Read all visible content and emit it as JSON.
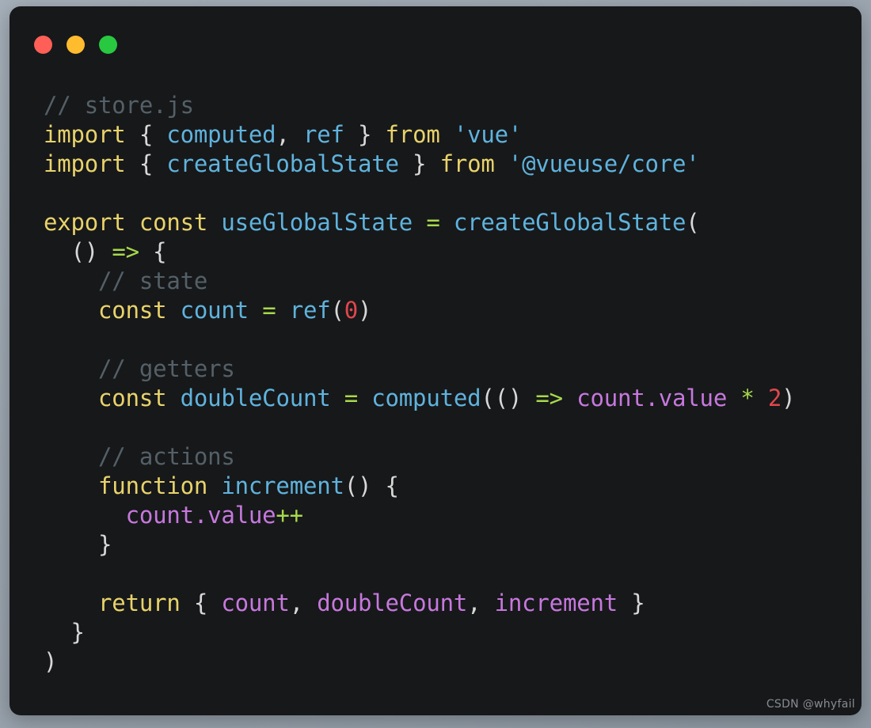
{
  "window": {
    "traffic_lights": [
      {
        "name": "close",
        "color": "#ff5f57"
      },
      {
        "name": "minimize",
        "color": "#febc2e"
      },
      {
        "name": "maximize",
        "color": "#28c840"
      }
    ]
  },
  "editor": {
    "language": "javascript",
    "filename": "store.js",
    "theme": {
      "background": "#17181a",
      "page_background": "#9ba5af",
      "comment": "#546067",
      "keyword": "#e8d36b",
      "identifier": "#5fb3dd",
      "string": "#5fb3dd",
      "punctuation": "#d8d8d8",
      "operator": "#a7d94c",
      "number": "#e0474c",
      "property": "#c678dd"
    },
    "lines": [
      {
        "n": 1,
        "text": "// store.js",
        "tokens": [
          {
            "t": "// store.js",
            "c": "comment"
          }
        ]
      },
      {
        "n": 2,
        "text": "import { computed, ref } from 'vue'",
        "tokens": [
          {
            "t": "import",
            "c": "keyword"
          },
          {
            "t": " ",
            "c": "plain"
          },
          {
            "t": "{",
            "c": "punct"
          },
          {
            "t": " ",
            "c": "plain"
          },
          {
            "t": "computed",
            "c": "ident"
          },
          {
            "t": ",",
            "c": "punct"
          },
          {
            "t": " ",
            "c": "plain"
          },
          {
            "t": "ref",
            "c": "ident"
          },
          {
            "t": " ",
            "c": "plain"
          },
          {
            "t": "}",
            "c": "punct"
          },
          {
            "t": " ",
            "c": "plain"
          },
          {
            "t": "from",
            "c": "keyword"
          },
          {
            "t": " ",
            "c": "plain"
          },
          {
            "t": "'vue'",
            "c": "string"
          }
        ]
      },
      {
        "n": 3,
        "text": "import { createGlobalState } from '@vueuse/core'",
        "tokens": [
          {
            "t": "import",
            "c": "keyword"
          },
          {
            "t": " ",
            "c": "plain"
          },
          {
            "t": "{",
            "c": "punct"
          },
          {
            "t": " ",
            "c": "plain"
          },
          {
            "t": "createGlobalState",
            "c": "ident"
          },
          {
            "t": " ",
            "c": "plain"
          },
          {
            "t": "}",
            "c": "punct"
          },
          {
            "t": " ",
            "c": "plain"
          },
          {
            "t": "from",
            "c": "keyword"
          },
          {
            "t": " ",
            "c": "plain"
          },
          {
            "t": "'@vueuse/core'",
            "c": "string"
          }
        ]
      },
      {
        "n": 4,
        "text": "",
        "tokens": []
      },
      {
        "n": 5,
        "text": "export const useGlobalState = createGlobalState(",
        "tokens": [
          {
            "t": "export",
            "c": "keyword"
          },
          {
            "t": " ",
            "c": "plain"
          },
          {
            "t": "const",
            "c": "keyword"
          },
          {
            "t": " ",
            "c": "plain"
          },
          {
            "t": "useGlobalState",
            "c": "ident"
          },
          {
            "t": " ",
            "c": "plain"
          },
          {
            "t": "=",
            "c": "operator"
          },
          {
            "t": " ",
            "c": "plain"
          },
          {
            "t": "createGlobalState",
            "c": "ident"
          },
          {
            "t": "(",
            "c": "punct"
          }
        ]
      },
      {
        "n": 6,
        "text": "  () => {",
        "tokens": [
          {
            "t": "  ",
            "c": "plain"
          },
          {
            "t": "()",
            "c": "punct"
          },
          {
            "t": " ",
            "c": "plain"
          },
          {
            "t": "=>",
            "c": "operator"
          },
          {
            "t": " ",
            "c": "plain"
          },
          {
            "t": "{",
            "c": "punct"
          }
        ]
      },
      {
        "n": 7,
        "text": "    // state",
        "tokens": [
          {
            "t": "    ",
            "c": "plain"
          },
          {
            "t": "// state",
            "c": "comment"
          }
        ]
      },
      {
        "n": 8,
        "text": "    const count = ref(0)",
        "tokens": [
          {
            "t": "    ",
            "c": "plain"
          },
          {
            "t": "const",
            "c": "keyword"
          },
          {
            "t": " ",
            "c": "plain"
          },
          {
            "t": "count",
            "c": "ident"
          },
          {
            "t": " ",
            "c": "plain"
          },
          {
            "t": "=",
            "c": "operator"
          },
          {
            "t": " ",
            "c": "plain"
          },
          {
            "t": "ref",
            "c": "ident"
          },
          {
            "t": "(",
            "c": "punct"
          },
          {
            "t": "0",
            "c": "number"
          },
          {
            "t": ")",
            "c": "punct"
          }
        ]
      },
      {
        "n": 9,
        "text": "",
        "tokens": []
      },
      {
        "n": 10,
        "text": "    // getters",
        "tokens": [
          {
            "t": "    ",
            "c": "plain"
          },
          {
            "t": "// getters",
            "c": "comment"
          }
        ]
      },
      {
        "n": 11,
        "text": "    const doubleCount = computed(() => count.value * 2)",
        "tokens": [
          {
            "t": "    ",
            "c": "plain"
          },
          {
            "t": "const",
            "c": "keyword"
          },
          {
            "t": " ",
            "c": "plain"
          },
          {
            "t": "doubleCount",
            "c": "ident"
          },
          {
            "t": " ",
            "c": "plain"
          },
          {
            "t": "=",
            "c": "operator"
          },
          {
            "t": " ",
            "c": "plain"
          },
          {
            "t": "computed",
            "c": "ident"
          },
          {
            "t": "((",
            "c": "punct"
          },
          {
            "t": ")",
            "c": "punct"
          },
          {
            "t": " ",
            "c": "plain"
          },
          {
            "t": "=>",
            "c": "operator"
          },
          {
            "t": " ",
            "c": "plain"
          },
          {
            "t": "count.value",
            "c": "prop"
          },
          {
            "t": " ",
            "c": "plain"
          },
          {
            "t": "*",
            "c": "operator"
          },
          {
            "t": " ",
            "c": "plain"
          },
          {
            "t": "2",
            "c": "number"
          },
          {
            "t": ")",
            "c": "punct"
          }
        ]
      },
      {
        "n": 12,
        "text": "",
        "tokens": []
      },
      {
        "n": 13,
        "text": "    // actions",
        "tokens": [
          {
            "t": "    ",
            "c": "plain"
          },
          {
            "t": "// actions",
            "c": "comment"
          }
        ]
      },
      {
        "n": 14,
        "text": "    function increment() {",
        "tokens": [
          {
            "t": "    ",
            "c": "plain"
          },
          {
            "t": "function",
            "c": "keyword"
          },
          {
            "t": " ",
            "c": "plain"
          },
          {
            "t": "increment",
            "c": "ident"
          },
          {
            "t": "()",
            "c": "punct"
          },
          {
            "t": " ",
            "c": "plain"
          },
          {
            "t": "{",
            "c": "punct"
          }
        ]
      },
      {
        "n": 15,
        "text": "      count.value++",
        "tokens": [
          {
            "t": "      ",
            "c": "plain"
          },
          {
            "t": "count.value",
            "c": "prop"
          },
          {
            "t": "++",
            "c": "operator"
          }
        ]
      },
      {
        "n": 16,
        "text": "    }",
        "tokens": [
          {
            "t": "    ",
            "c": "plain"
          },
          {
            "t": "}",
            "c": "punct"
          }
        ]
      },
      {
        "n": 17,
        "text": "",
        "tokens": []
      },
      {
        "n": 18,
        "text": "    return { count, doubleCount, increment }",
        "tokens": [
          {
            "t": "    ",
            "c": "plain"
          },
          {
            "t": "return",
            "c": "keyword"
          },
          {
            "t": " ",
            "c": "plain"
          },
          {
            "t": "{",
            "c": "punct"
          },
          {
            "t": " ",
            "c": "plain"
          },
          {
            "t": "count",
            "c": "prop"
          },
          {
            "t": ",",
            "c": "punct"
          },
          {
            "t": " ",
            "c": "plain"
          },
          {
            "t": "doubleCount",
            "c": "prop"
          },
          {
            "t": ",",
            "c": "punct"
          },
          {
            "t": " ",
            "c": "plain"
          },
          {
            "t": "increment",
            "c": "prop"
          },
          {
            "t": " ",
            "c": "plain"
          },
          {
            "t": "}",
            "c": "punct"
          }
        ]
      },
      {
        "n": 19,
        "text": "  }",
        "tokens": [
          {
            "t": "  ",
            "c": "plain"
          },
          {
            "t": "}",
            "c": "punct"
          }
        ]
      },
      {
        "n": 20,
        "text": ")",
        "tokens": [
          {
            "t": ")",
            "c": "punct"
          }
        ]
      }
    ]
  },
  "watermark": {
    "text": "CSDN @whyfail"
  }
}
